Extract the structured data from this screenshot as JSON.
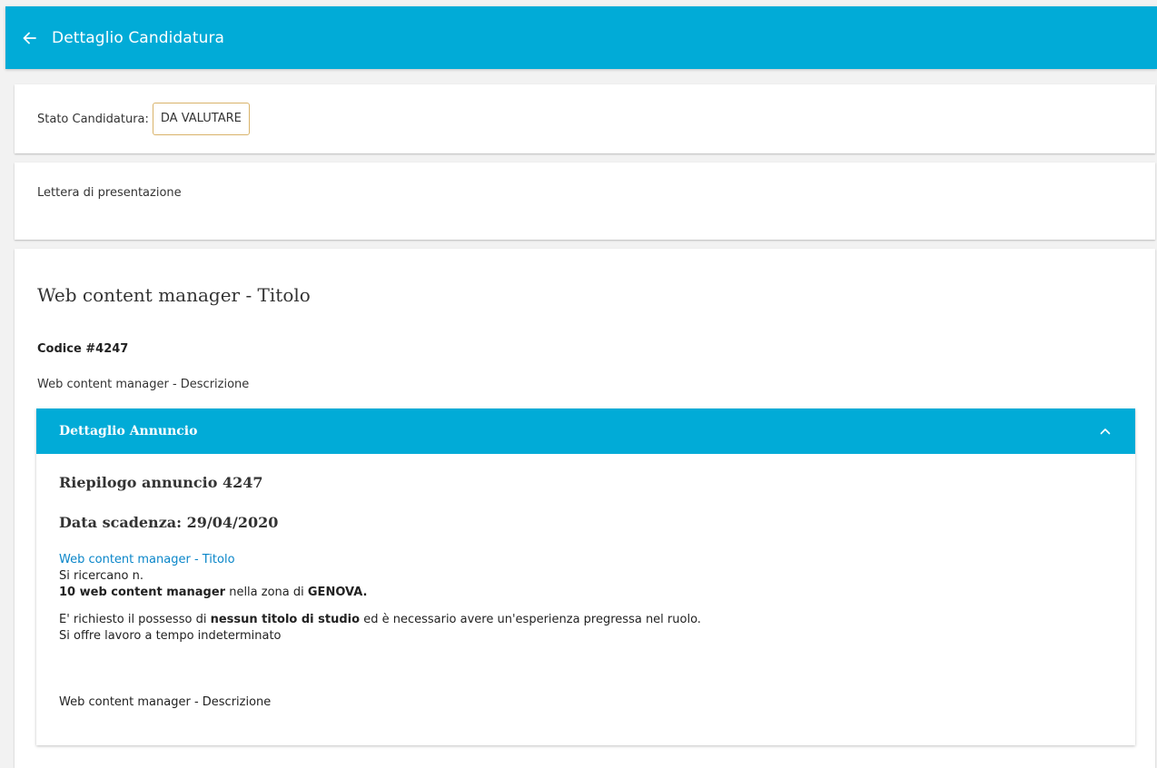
{
  "topbar": {
    "title": "Dettaglio Candidatura",
    "back_icon": "arrow-left-icon",
    "color": "#01abd7"
  },
  "status": {
    "label": "Stato Candidatura:",
    "value": "DA VALUTARE",
    "badge_border_color": "#d9b36a"
  },
  "letter": {
    "label": "Lettera di presentazione"
  },
  "job": {
    "title": "Web content manager - Titolo",
    "code": "Codice #4247",
    "description": "Web content manager - Descrizione"
  },
  "panel": {
    "header": "Dettaglio Annuncio",
    "toggle_icon": "chevron-up-icon",
    "summary_title": "Riepilogo annuncio 4247",
    "deadline": "Data scadenza: 29/04/2020",
    "link_text": "Web content manager - Titolo",
    "seeking": "Si ricercano n.",
    "count_role": "10 web content manager",
    "zone_text": " nella zona di ",
    "zone": "GENOVA.",
    "req_pre": "E' richiesto il possesso di ",
    "req_bold": "nessun titolo di studio",
    "req_post": " ed è necessario avere un'esperienza pregressa nel ruolo.",
    "contract": "Si offre lavoro a tempo indeterminato",
    "description": "Web content manager - Descrizione",
    "link_color": "#0a86c9"
  }
}
